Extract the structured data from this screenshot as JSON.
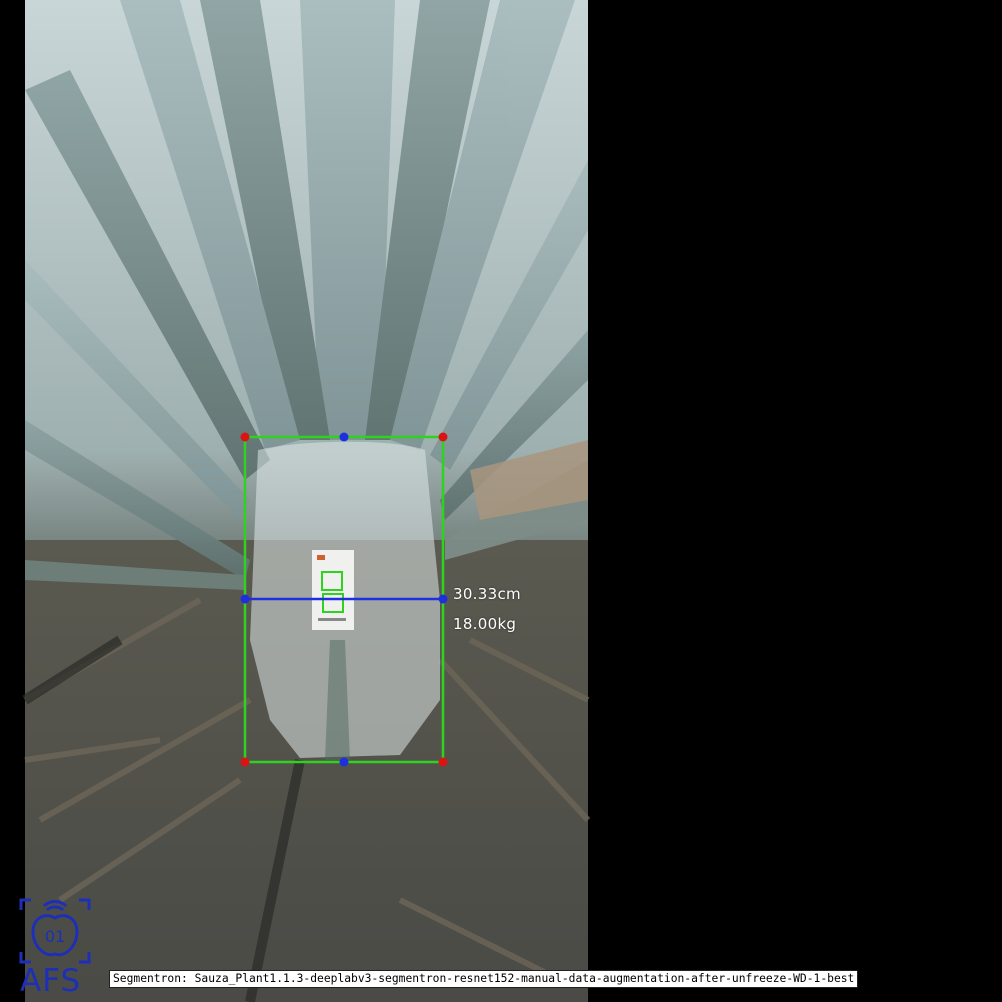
{
  "measurement": {
    "width_text": "30.33cm",
    "weight_text": "18.00kg"
  },
  "caption": {
    "text": "Segmentron: Sauza_Plant1.1.3-deeplabv3-segmentron-resnet152-manual-data-augmentation-after-unfreeze-WD-1-best"
  },
  "logo": {
    "text": "AFS",
    "badge_text": "01"
  },
  "colors": {
    "bounding_box": "#2fd21e",
    "measure_line": "#1f2fe0",
    "corner_marker": "#d81414",
    "midpoint_marker": "#1f2fe0",
    "logo": "#1d2fb8",
    "background": "#000000"
  }
}
